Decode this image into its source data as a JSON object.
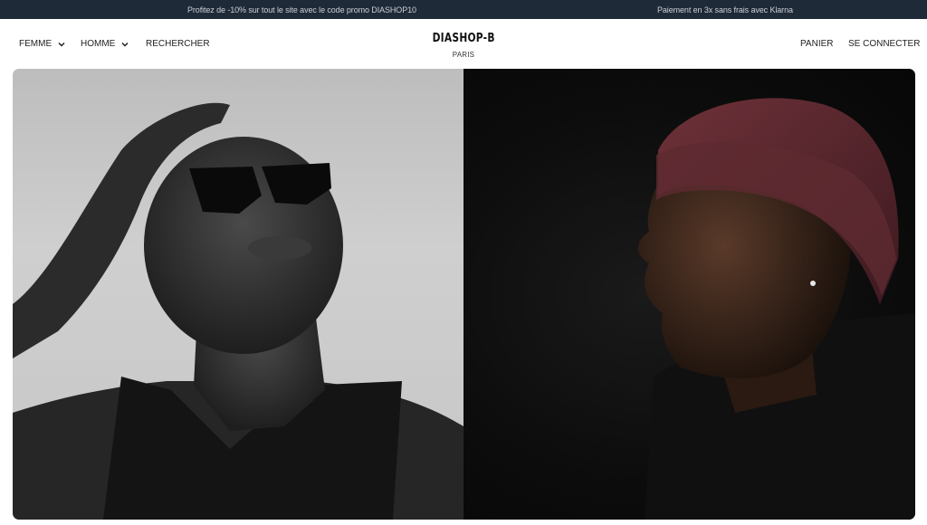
{
  "promo": {
    "left_text": "Profitez de -10% sur tout le site avec le code promo DIASHOP10",
    "right_text": "Paiement en 3x sans frais avec Klarna"
  },
  "nav": {
    "femme": "FEMME",
    "homme": "HOMME",
    "search": "RECHERCHER",
    "cart": "PANIER",
    "login": "SE CONNECTER"
  },
  "brand": {
    "name": "DIASHOP-B",
    "city": "PARIS"
  },
  "colors": {
    "promo_bar": "#1f2a38",
    "beanie": "#5e2a31"
  },
  "hero": {
    "left_image": "woman-sunglasses-portrait",
    "right_image": "man-beanie-profile-portrait"
  }
}
